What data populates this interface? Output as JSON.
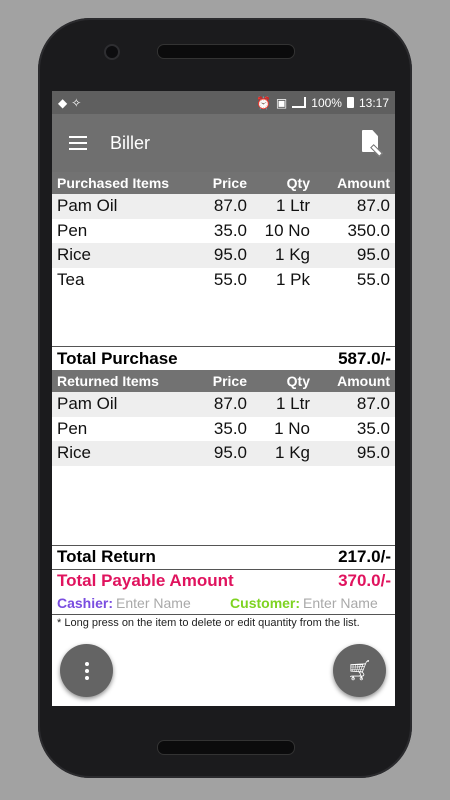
{
  "status": {
    "battery": "100%",
    "time": "13:17"
  },
  "appbar": {
    "title": "Biller"
  },
  "purchased": {
    "headers": {
      "name": "Purchased Items",
      "price": "Price",
      "qty": "Qty",
      "amount": "Amount"
    },
    "rows": [
      {
        "name": "Pam Oil",
        "price": "87.0",
        "qty": "1 Ltr",
        "amount": "87.0"
      },
      {
        "name": "Pen",
        "price": "35.0",
        "qty": "10 No",
        "amount": "350.0"
      },
      {
        "name": "Rice",
        "price": "95.0",
        "qty": "1 Kg",
        "amount": "95.0"
      },
      {
        "name": "Tea",
        "price": "55.0",
        "qty": "1 Pk",
        "amount": "55.0"
      }
    ],
    "total_label": "Total Purchase",
    "total_value": "587.0/-"
  },
  "returned": {
    "headers": {
      "name": "Returned Items",
      "price": "Price",
      "qty": "Qty",
      "amount": "Amount"
    },
    "rows": [
      {
        "name": "Pam Oil",
        "price": "87.0",
        "qty": "1 Ltr",
        "amount": "87.0"
      },
      {
        "name": "Pen",
        "price": "35.0",
        "qty": "1 No",
        "amount": "35.0"
      },
      {
        "name": "Rice",
        "price": "95.0",
        "qty": "1 Kg",
        "amount": "95.0"
      }
    ],
    "total_label": "Total Return",
    "total_value": "217.0/-"
  },
  "payable": {
    "label": "Total Payable Amount",
    "value": "370.0/-"
  },
  "cashier": {
    "label": "Cashier:",
    "placeholder": "Enter Name"
  },
  "customer": {
    "label": "Customer:",
    "placeholder": "Enter Name"
  },
  "hint": "* Long press on the item to delete or edit quantity from the list.",
  "colors": {
    "accent_pink": "#e0135e",
    "cashier_purple": "#7a4de0",
    "customer_green": "#7ed321",
    "toolbar_grey": "#6f6f6f"
  },
  "icons": {
    "menu": "hamburger-icon",
    "report": "edit-document-icon",
    "more": "more-vert-icon",
    "cart": "shopping-cart-icon"
  }
}
